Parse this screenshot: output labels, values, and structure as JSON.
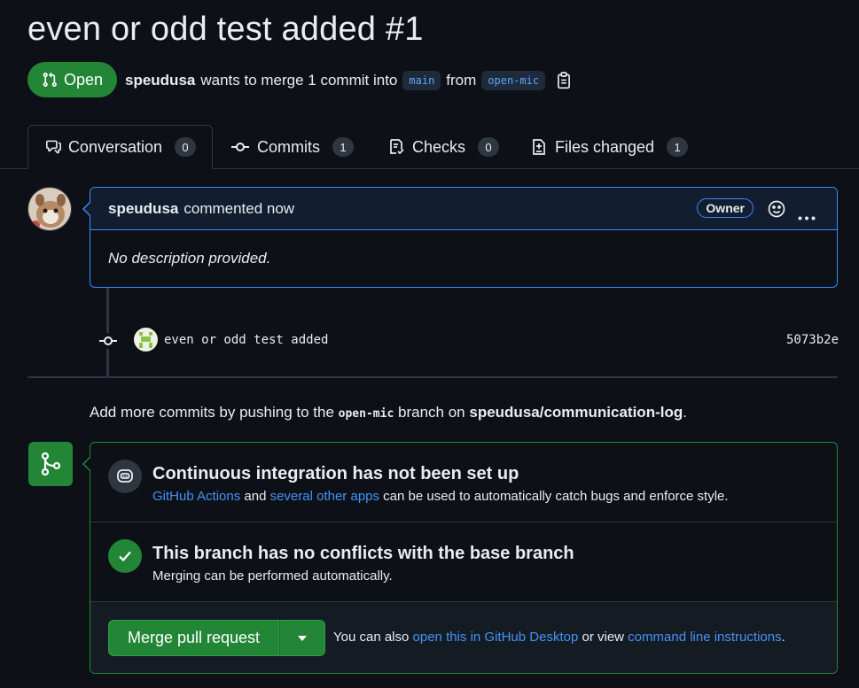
{
  "pr": {
    "title": "even or odd test added",
    "number": "#1",
    "state": "Open",
    "author": "speudusa",
    "summary_pre": "wants to merge 1 commit into",
    "base_branch": "main",
    "from_word": "from",
    "head_branch": "open-mic"
  },
  "tabs": [
    {
      "label": "Conversation",
      "count": "0"
    },
    {
      "label": "Commits",
      "count": "1"
    },
    {
      "label": "Checks",
      "count": "0"
    },
    {
      "label": "Files changed",
      "count": "1"
    }
  ],
  "comment": {
    "author": "speudusa",
    "meta": "commented now",
    "badge": "Owner",
    "body": "No description provided."
  },
  "commit": {
    "message": "even or odd test added",
    "sha": "5073b2e"
  },
  "push_hint": {
    "pre": "Add more commits by pushing to the",
    "branch": "open-mic",
    "mid": "branch on",
    "repo": "speudusa/communication-log",
    "post": "."
  },
  "merge": {
    "ci_title": "Continuous integration has not been set up",
    "ci_link1": "GitHub Actions",
    "ci_and": "and",
    "ci_link2": "several other apps",
    "ci_rest": "can be used to automatically catch bugs and enforce style.",
    "conflict_title": "This branch has no conflicts with the base branch",
    "conflict_desc": "Merging can be performed automatically.",
    "button_label": "Merge pull request",
    "alt_pre": "You can also",
    "alt_link1": "open this in GitHub Desktop",
    "alt_mid": "or view",
    "alt_link2": "command line instructions",
    "alt_post": "."
  },
  "colors": {
    "background": "#0d1117",
    "accent_green": "#238636",
    "link_blue": "#4493f8",
    "comment_border": "#388bfd"
  }
}
